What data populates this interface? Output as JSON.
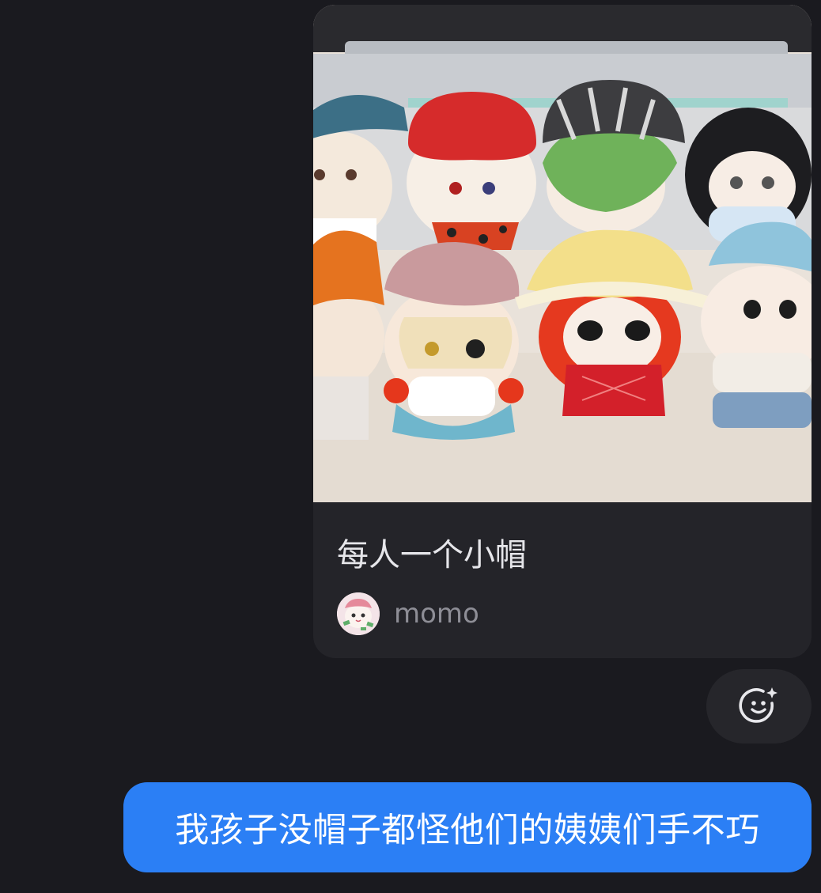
{
  "shared_post": {
    "title": "每人一个小帽",
    "author_name": "momo",
    "photo_icon": "plush-dolls-with-hats-photo",
    "avatar_icon": "momo-avatar-icon"
  },
  "react_button": {
    "icon": "add-reaction-smiley-icon"
  },
  "outgoing_message": {
    "text": "我孩子没帽子都怪他们的姨姨们手不巧"
  },
  "colors": {
    "background": "#1a1a1f",
    "card": "#242429",
    "bubble": "#2b7ff5"
  }
}
